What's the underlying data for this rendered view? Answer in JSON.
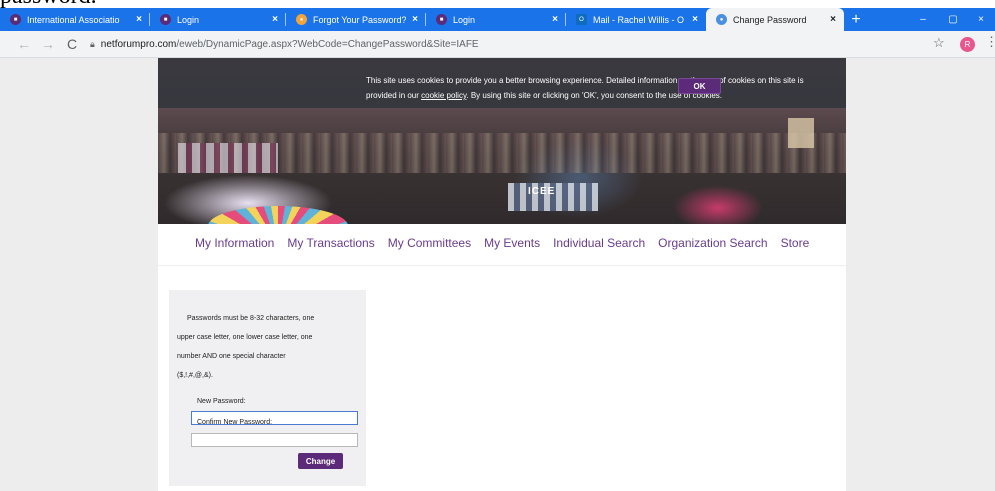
{
  "doc_overflow_text": "password.",
  "browser": {
    "tabs": [
      {
        "title": "International Associatio",
        "favicon_color": "#5b2a79",
        "active": false
      },
      {
        "title": "Login",
        "favicon_color": "#5b2a79",
        "active": false
      },
      {
        "title": "Forgot Your Password?",
        "favicon_color": "#f2a33a",
        "active": false
      },
      {
        "title": "Login",
        "favicon_color": "#5b2a79",
        "active": false
      },
      {
        "title": "Mail - Rachel Willis - O",
        "favicon_color": "#0f6cbd",
        "active": false
      },
      {
        "title": "Change Password",
        "favicon_color": "#4a90e2",
        "active": true
      }
    ],
    "tab_close": "×",
    "new_tab": "+",
    "win_minimize": "–",
    "win_restore": "▢",
    "win_close": "×",
    "nav_back": "←",
    "nav_forward": "→",
    "nav_reload": "C",
    "url_host": "netforumpro.com",
    "url_path": "/eweb/DynamicPage.aspx?WebCode=ChangePassword&Site=IAFE",
    "bookmark_star": "☆",
    "profile_initial": "R",
    "menu": "⋮"
  },
  "cookie_banner": {
    "text_before": "This site uses cookies to provide you a better browsing experience. Detailed information on the use of cookies on this site is provided in our ",
    "link": "cookie policy",
    "text_after": ". By using this site or clicking on 'OK', you consent to the use of cookies.",
    "ok": "OK"
  },
  "banner": {
    "sign": "ICEE"
  },
  "nav": {
    "items": [
      "My Information",
      "My Transactions",
      "My Committees",
      "My Events",
      "Individual Search",
      "Organization Search",
      "Store"
    ]
  },
  "form": {
    "rule_line1": "Passwords must be 8-32 characters, one",
    "rule_line2": "upper case letter, one lower case letter, one",
    "rule_line3": "number AND one special character",
    "rule_line4": "($,!,#,@,&).",
    "new_password_label": "New Password:",
    "new_password_value": "",
    "confirm_password_label": "Confirm New Password:",
    "confirm_password_value": "",
    "submit": "Change"
  },
  "colors": {
    "tabstrip": "#1a73e8",
    "brand_purple": "#5b2a79",
    "nav_link": "#6a3c8c",
    "page_bg": "#ededed"
  }
}
